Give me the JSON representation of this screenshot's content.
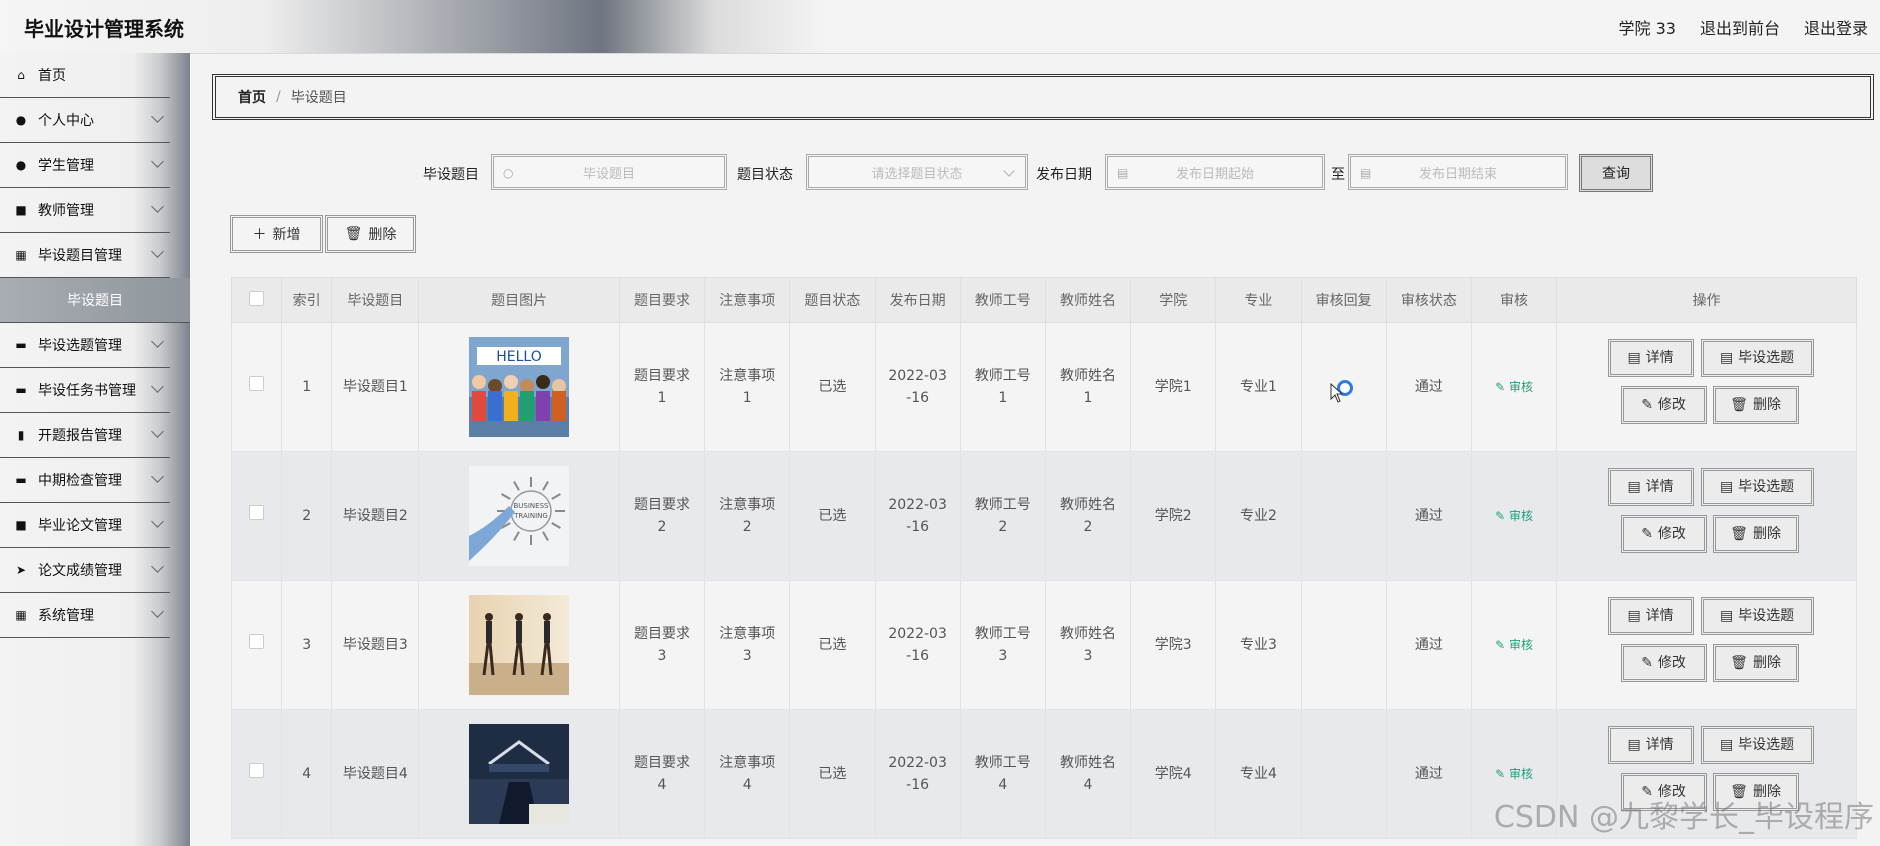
{
  "app": {
    "title": "毕业设计管理系统"
  },
  "header": {
    "user": "学院 33",
    "to_front": "退出到前台",
    "logout": "退出登录"
  },
  "sidebar": {
    "items": [
      {
        "label": "首页",
        "icon": "home-icon",
        "glyph": "⌂"
      },
      {
        "label": "个人中心",
        "icon": "user-icon",
        "glyph": "●"
      },
      {
        "label": "学生管理",
        "icon": "student-icon",
        "glyph": "●"
      },
      {
        "label": "教师管理",
        "icon": "teacher-icon",
        "glyph": "■"
      },
      {
        "label": "毕设题目管理",
        "icon": "grid-icon",
        "glyph": "▦"
      },
      {
        "label": "毕设选题管理",
        "icon": "chat-icon",
        "glyph": "▬"
      },
      {
        "label": "毕设任务书管理",
        "icon": "print-icon",
        "glyph": "▬"
      },
      {
        "label": "开题报告管理",
        "icon": "chart-icon",
        "glyph": "▮"
      },
      {
        "label": "中期检查管理",
        "icon": "ticket-icon",
        "glyph": "▬"
      },
      {
        "label": "毕业论文管理",
        "icon": "clipboard-icon",
        "glyph": "■"
      },
      {
        "label": "论文成绩管理",
        "icon": "send-icon",
        "glyph": "➤"
      },
      {
        "label": "系统管理",
        "icon": "grid-icon",
        "glyph": "▦"
      }
    ],
    "active_sub": "毕设题目"
  },
  "breadcrumb": {
    "home": "首页",
    "sep": "/",
    "current": "毕设题目"
  },
  "search": {
    "topic_label": "毕设题目",
    "topic_placeholder": "毕设题目",
    "status_label": "题目状态",
    "status_placeholder": "请选择题目状态",
    "date_label": "发布日期",
    "date_start_placeholder": "发布日期起始",
    "to": "至",
    "date_end_placeholder": "发布日期结束",
    "query": "查询"
  },
  "actions": {
    "add": "新增",
    "delete": "删除"
  },
  "table": {
    "columns": [
      "索引",
      "毕设题目",
      "题目图片",
      "题目要求",
      "注意事项",
      "题目状态",
      "发布日期",
      "教师工号",
      "教师姓名",
      "学院",
      "专业",
      "审核回复",
      "审核状态",
      "审核",
      "操作"
    ],
    "rows": [
      {
        "index": "1",
        "topic": "毕设题目1",
        "req": "题目要求1",
        "note": "注意事项1",
        "status": "已选",
        "date": "2022-03-16",
        "tid": "教师工号1",
        "tname": "教师姓名1",
        "college": "学院1",
        "major": "专业1",
        "reply": "",
        "audit_status": "通过",
        "audit": "审核"
      },
      {
        "index": "2",
        "topic": "毕设题目2",
        "req": "题目要求2",
        "note": "注意事项2",
        "status": "已选",
        "date": "2022-03-16",
        "tid": "教师工号2",
        "tname": "教师姓名2",
        "college": "学院2",
        "major": "专业2",
        "reply": "",
        "audit_status": "通过",
        "audit": "审核"
      },
      {
        "index": "3",
        "topic": "毕设题目3",
        "req": "题目要求3",
        "note": "注意事项3",
        "status": "已选",
        "date": "2022-03-16",
        "tid": "教师工号3",
        "tname": "教师姓名3",
        "college": "学院3",
        "major": "专业3",
        "reply": "",
        "audit_status": "通过",
        "audit": "审核"
      },
      {
        "index": "4",
        "topic": "毕设题目4",
        "req": "题目要求4",
        "note": "注意事项4",
        "status": "已选",
        "date": "2022-03-16",
        "tid": "教师工号4",
        "tname": "教师姓名4",
        "college": "学院4",
        "major": "专业4",
        "reply": "",
        "audit_status": "通过",
        "audit": "审核"
      }
    ],
    "ops": {
      "detail": "详情",
      "select": "毕设选题",
      "edit": "修改",
      "delete": "删除"
    }
  },
  "watermark": "CSDN @九黎学长_毕设程序",
  "colors": {
    "audit_link": "#20a07a",
    "cursor": "#2b7be0"
  }
}
